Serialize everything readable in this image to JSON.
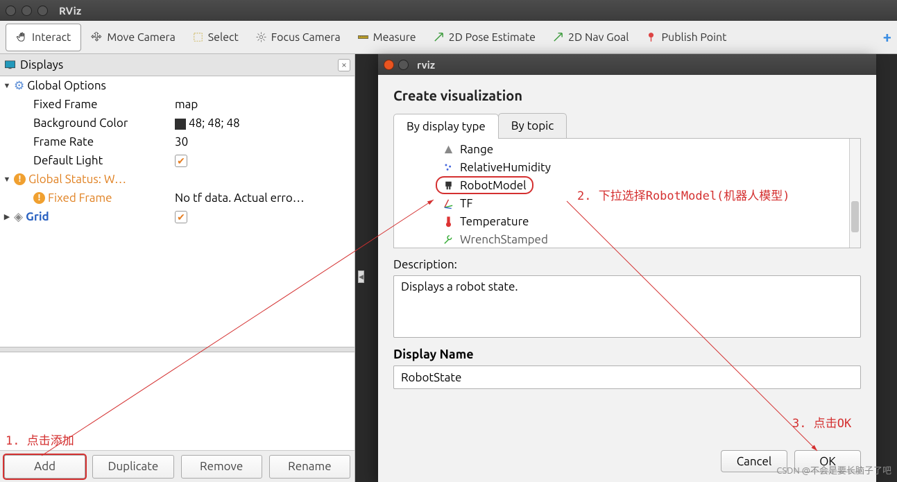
{
  "window": {
    "title": "RViz"
  },
  "toolbar": {
    "interact": "Interact",
    "move_camera": "Move Camera",
    "select": "Select",
    "focus_camera": "Focus Camera",
    "measure": "Measure",
    "pose_estimate": "2D Pose Estimate",
    "nav_goal": "2D Nav Goal",
    "publish_point": "Publish Point"
  },
  "panel": {
    "title": "Displays",
    "global_options": "Global Options",
    "fixed_frame_label": "Fixed Frame",
    "fixed_frame_value": "map",
    "bg_color_label": "Background Color",
    "bg_color_value": "48; 48; 48",
    "frame_rate_label": "Frame Rate",
    "frame_rate_value": "30",
    "default_light_label": "Default Light",
    "global_status": "Global Status: W…",
    "fixed_frame_status": "Fixed Frame",
    "fixed_frame_status_value": "No tf data.  Actual erro…",
    "grid": "Grid"
  },
  "buttons": {
    "add": "Add",
    "duplicate": "Duplicate",
    "remove": "Remove",
    "rename": "Rename"
  },
  "dialog": {
    "title": "rviz",
    "heading": "Create visualization",
    "tab_type": "By display type",
    "tab_topic": "By topic",
    "types": {
      "range": "Range",
      "relhum": "RelativeHumidity",
      "robotmodel": "RobotModel",
      "tf": "TF",
      "temperature": "Temperature",
      "wrench": "WrenchStamped"
    },
    "desc_label": "Description:",
    "desc_text": "Displays a robot state.",
    "name_label": "Display Name",
    "name_value": "RobotState",
    "cancel": "Cancel",
    "ok": "OK"
  },
  "annotations": {
    "a1": "1. 点击添加",
    "a2": "2. 下拉选择RobotModel(机器人模型)",
    "a3": "3. 点击OK"
  },
  "watermark": "CSDN @不会是要长脑子了吧"
}
